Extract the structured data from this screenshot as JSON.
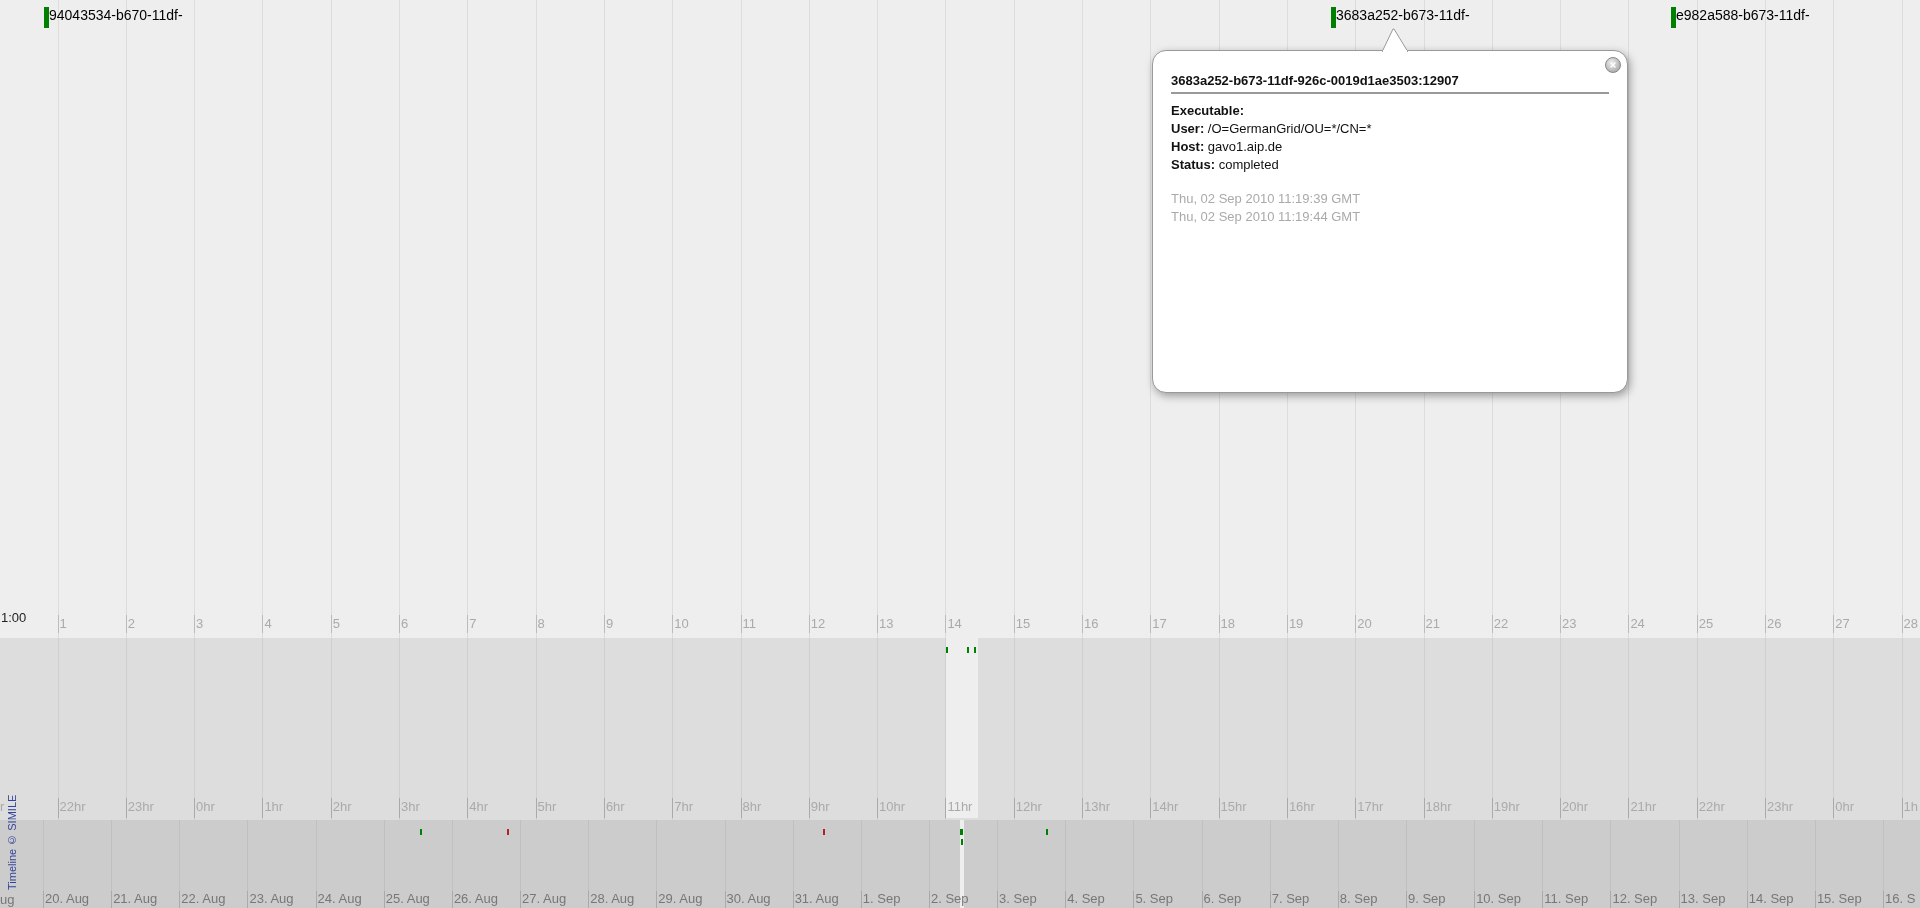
{
  "detail_band": {
    "scale_label": "1:00",
    "ticks": [
      "1",
      "2",
      "3",
      "4",
      "5",
      "6",
      "7",
      "8",
      "9",
      "10",
      "11",
      "12",
      "13",
      "14",
      "15",
      "16",
      "17",
      "18",
      "19",
      "20",
      "21",
      "22",
      "23",
      "24",
      "25",
      "26",
      "27",
      "28"
    ],
    "events": [
      {
        "label": "94043534-b670-11df-",
        "color": "#008000"
      },
      {
        "label": "3683a252-b673-11df-",
        "color": "#008000"
      },
      {
        "label": "e982a588-b673-11df-",
        "color": "#008000"
      }
    ]
  },
  "popup": {
    "title": "3683a252-b673-11df-926c-0019d1ae3503:12907",
    "fields": [
      {
        "label": "Executable:"
      },
      {
        "label": "User:",
        "value": "/O=GermanGrid/OU=*/CN=*"
      },
      {
        "label": "Host:",
        "value": "gavo1.aip.de"
      },
      {
        "label": "Status:",
        "value": "completed"
      }
    ],
    "times": [
      "Thu, 02 Sep 2010 11:19:39 GMT",
      "Thu, 02 Sep 2010 11:19:44 GMT"
    ]
  },
  "hour_band": {
    "first_tick": "r",
    "ticks": [
      "22hr",
      "23hr",
      "0hr",
      "1hr",
      "2hr",
      "3hr",
      "4hr",
      "5hr",
      "6hr",
      "7hr",
      "8hr",
      "9hr",
      "10hr",
      "11hr",
      "12hr",
      "13hr",
      "14hr",
      "15hr",
      "16hr",
      "17hr",
      "18hr",
      "19hr",
      "20hr",
      "21hr",
      "22hr",
      "23hr",
      "0hr",
      "1h"
    ],
    "marks": [
      {
        "color": "#008000"
      },
      {
        "color": "#008000"
      },
      {
        "color": "#008000"
      }
    ]
  },
  "day_band": {
    "first_tick": "ug",
    "ticks": [
      "20. Aug",
      "21. Aug",
      "22. Aug",
      "23. Aug",
      "24. Aug",
      "25. Aug",
      "26. Aug",
      "27. Aug",
      "28. Aug",
      "29. Aug",
      "30. Aug",
      "31. Aug",
      "1. Sep",
      "2. Sep",
      "3. Sep",
      "4. Sep",
      "5. Sep",
      "6. Sep",
      "7. Sep",
      "8. Sep",
      "9. Sep",
      "10. Sep",
      "11. Sep",
      "12. Sep",
      "13. Sep",
      "14. Sep",
      "15. Sep",
      "16. S"
    ],
    "marks": [
      {
        "color": "#008000"
      },
      {
        "color": "#b22222"
      },
      {
        "color": "#b22222"
      },
      {
        "color": "#008000"
      },
      {
        "color": "#008000"
      },
      {
        "color": "#008000"
      }
    ]
  },
  "credit": "Timeline © SIMILE"
}
